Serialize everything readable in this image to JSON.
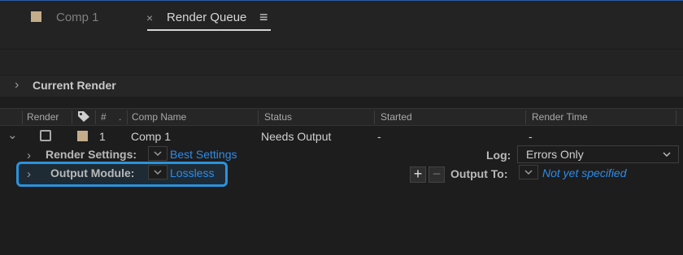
{
  "tabs": {
    "comp_tab_label": "Comp 1",
    "close_glyph": "×",
    "active_tab_label": "Render Queue",
    "menu_glyph": "≡"
  },
  "current_render": {
    "chevron": "›",
    "label": "Current Render"
  },
  "columns": {
    "render": "Render",
    "number": "#",
    "dot": ".",
    "comp_name": "Comp Name",
    "status": "Status",
    "started": "Started",
    "render_time": "Render Time"
  },
  "row": {
    "expand": "⌄",
    "number": "1",
    "comp_name": "Comp 1",
    "status": "Needs Output",
    "started": "-",
    "render_time": "-"
  },
  "render_settings": {
    "label": "Render Settings:",
    "value": "Best Settings"
  },
  "log": {
    "label": "Log:",
    "value": "Errors Only"
  },
  "output_module": {
    "label": "Output Module:",
    "value": "Lossless"
  },
  "output_to": {
    "add": "+",
    "remove": "−",
    "label": "Output To:",
    "value": "Not yet specified"
  },
  "colors": {
    "accent": "#2b92dc",
    "link": "#2d8ceb",
    "label_swatch": "#c4ad8a",
    "background": "#1d1d1d"
  }
}
